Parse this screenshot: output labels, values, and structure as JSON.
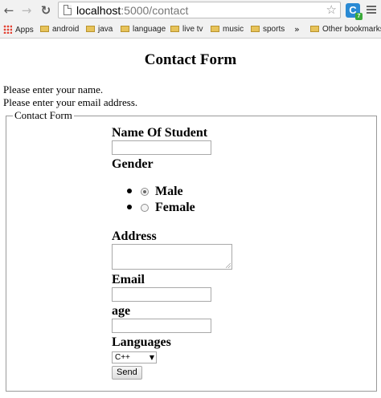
{
  "browser": {
    "url_host": "localhost",
    "url_path": ":5000/contact",
    "extension_badge": "7",
    "extension_letter": "C",
    "bookmarks": [
      {
        "label": "Apps"
      },
      {
        "label": "android"
      },
      {
        "label": "java"
      },
      {
        "label": "language"
      },
      {
        "label": "live tv"
      },
      {
        "label": "music"
      },
      {
        "label": "sports"
      },
      {
        "label": "»"
      },
      {
        "label": "Other bookmarks"
      }
    ]
  },
  "page": {
    "title": "Contact Form",
    "messages": [
      "Please enter your name.",
      "Please enter your email address."
    ],
    "fieldset_legend": "Contact Form",
    "fields": {
      "name_label": "Name Of Student",
      "name_value": "",
      "gender_label": "Gender",
      "gender_options": [
        {
          "label": "Male",
          "checked": true
        },
        {
          "label": "Female",
          "checked": false
        }
      ],
      "address_label": "Address",
      "email_label": "Email",
      "age_label": "age",
      "languages_label": "Languages",
      "language_selected": "C++",
      "submit_label": "Send"
    }
  },
  "colors": {
    "chrome_bg": "#f1f1f1",
    "extension": "#2a8ad4",
    "folder": "#e7c35a"
  }
}
